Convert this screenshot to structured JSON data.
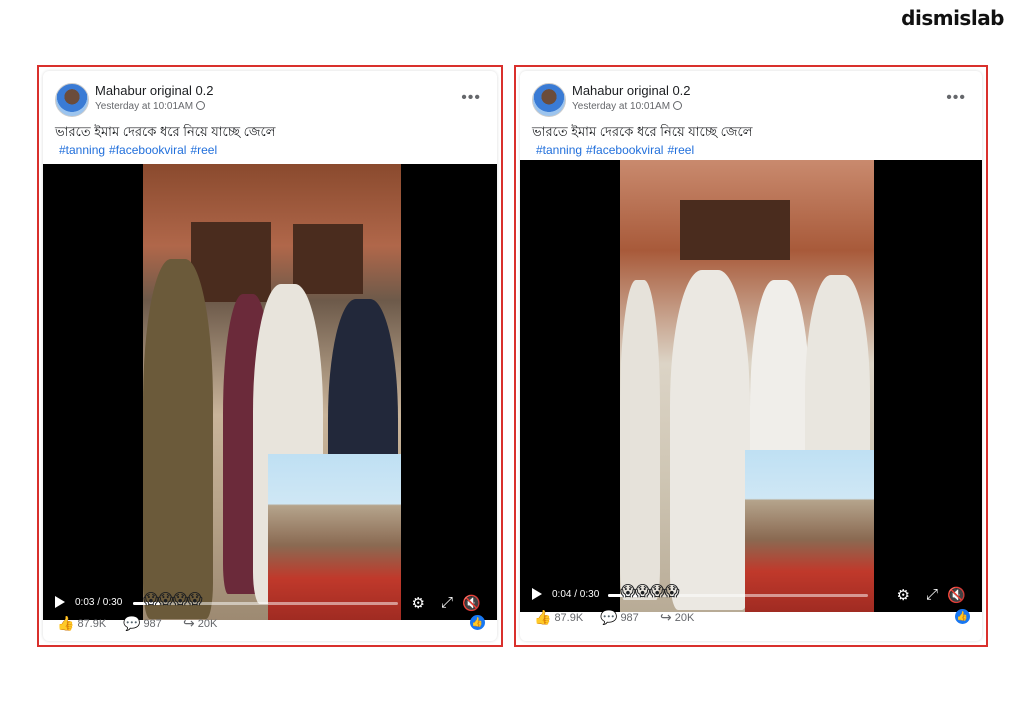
{
  "brand": "dismislab",
  "posts": [
    {
      "author": "Mahabur original 0.2",
      "time": "Yesterday at 10:01AM",
      "caption": "ভারতে ইমাম দেরকে ধরে নিয়ে যাচ্ছে জেলে",
      "tags": [
        "#tanning",
        "#facebookviral",
        "#reel"
      ],
      "video": {
        "time": "0:03 / 0:30",
        "progress": 0.1,
        "emojis": "😱😱😱😱"
      },
      "stats": {
        "likes": "87.9K",
        "comments": "987",
        "shares": "20K"
      }
    },
    {
      "author": "Mahabur original 0.2",
      "time": "Yesterday at 10:01AM",
      "caption": "ভারতে ইমাম দেরকে ধরে নিয়ে যাচ্ছে জেলে",
      "tags": [
        "#tanning",
        "#facebookviral",
        "#reel"
      ],
      "video": {
        "time": "0:04 / 0:30",
        "progress": 0.13,
        "emojis": "😱😱😱😱"
      },
      "stats": {
        "likes": "87.9K",
        "comments": "987",
        "shares": "20K"
      }
    }
  ],
  "icons": {
    "more": "more-horizontal-icon",
    "play": "play-icon",
    "settings": "gear-icon",
    "fullscreen": "expand-icon",
    "mute": "mute-icon",
    "like": "thumbs-up-icon",
    "comment": "comment-icon",
    "share": "share-icon"
  },
  "colors": {
    "frame": "#d9302c",
    "link": "#216fdb",
    "like_badge": "#1877f2"
  }
}
